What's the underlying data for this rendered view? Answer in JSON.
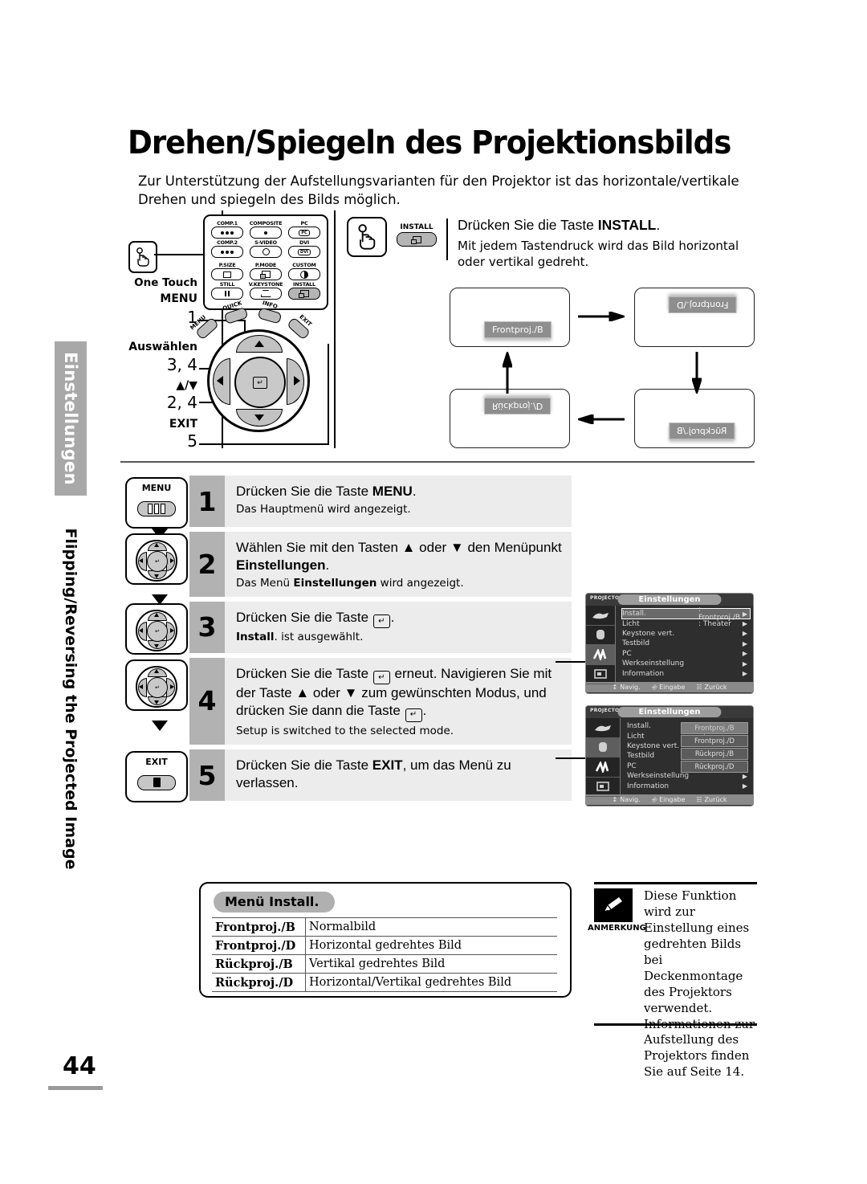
{
  "page": {
    "title": "Drehen/Spiegeln des Projektionsbilds",
    "intro": "Zur Unterstützung der Aufstellungsvarianten für den Projektor ist das horizontale/vertikale Drehen und spiegeln des Bilds möglich.",
    "number": "44"
  },
  "sidebar": {
    "tab_label": "Einstellungen",
    "sub_label": "Flipping/Reversing the Projected Image"
  },
  "remote": {
    "labels": {
      "one_touch": "One Touch",
      "menu": "MENU",
      "menu_step": "1",
      "auswaehlen": "Auswählen",
      "auswaehlen_steps": "3, 4",
      "updown": "▲/▼",
      "updown_steps": "2, 4",
      "exit": "EXIT",
      "exit_step": "5"
    },
    "source_buttons": [
      "COMP.1",
      "COMPOSITE",
      "PC",
      "COMP.2",
      "S-VIDEO",
      "DVI"
    ],
    "func_buttons": [
      "P.SIZE",
      "P.MODE",
      "CUSTOM",
      "STILL",
      "V.KEYSTONE",
      "INSTALL"
    ],
    "pad_keys": [
      "MENU",
      "QUICK",
      "INFO",
      "EXIT"
    ],
    "pc_cap": "PC",
    "dvi_cap": "DVI"
  },
  "install": {
    "key_label": "INSTALL",
    "heading_prefix": "Drücken Sie die Taste ",
    "heading_bold": "INSTALL",
    "heading_suffix": ".",
    "subtext": "Mit jedem Tastendruck wird das Bild horizontal oder vertikal gedreht."
  },
  "projection_cycle": [
    "Frontproj./B",
    "Frontproj./D",
    "Rückproj./B",
    "Rückproj./D"
  ],
  "steps": [
    {
      "number": "1",
      "key": "MENU",
      "main_pre": "Drücken Sie die Taste ",
      "main_bold": "MENU",
      "main_post": ".",
      "sub": "Das Hauptmenü wird angezeigt."
    },
    {
      "number": "2",
      "key": "",
      "main_pre": "Wählen Sie mit den Tasten ▲ oder ▼ den Menüpunkt ",
      "main_bold": "Einstellungen",
      "main_post": ".",
      "sub_pre": "Das Menü ",
      "sub_bold": "Einstellungen",
      "sub_post": " wird angezeigt."
    },
    {
      "number": "3",
      "key": "",
      "main_pre": "Drücken Sie die Taste ",
      "main_post": ".",
      "sub_bold": "Install",
      "sub_post": ". ist ausgewählt."
    },
    {
      "number": "4",
      "key": "",
      "main_pre": "Drücken Sie die Taste ",
      "main_mid": " erneut. Navigieren Sie mit der Taste ▲ oder ▼ zum gewünschten Modus, und drücken Sie dann die Taste ",
      "main_post": ".",
      "sub": "Setup is switched to the selected mode."
    },
    {
      "number": "5",
      "key": "EXIT",
      "main_pre": "Drücken Sie die Taste ",
      "main_bold": "EXIT",
      "main_post": ", um das Menü zu verlassen.",
      "sub": ""
    }
  ],
  "osd": {
    "brand": "PROJECTOR",
    "title": "Einstellungen",
    "rows": [
      {
        "name": "Install.",
        "value": ": Frontproj./B"
      },
      {
        "name": "Licht",
        "value": ": Theater"
      },
      {
        "name": "Keystone vert.",
        "value": ""
      },
      {
        "name": "Testbild",
        "value": ""
      },
      {
        "name": "PC",
        "value": ""
      },
      {
        "name": "Werkseinstellung",
        "value": ""
      },
      {
        "name": "Information",
        "value": ""
      }
    ],
    "footer": {
      "navigate": "Navig.",
      "enter": "Eingabe",
      "back": "Zurück"
    },
    "popup_options": [
      "Frontproj./B",
      "Frontproj./D",
      "Rückproj./B",
      "Rückproj./D"
    ]
  },
  "install_table": {
    "badge": "Menü Install.",
    "rows": [
      {
        "mode": "Frontproj./B",
        "desc": "Normalbild"
      },
      {
        "mode": "Frontproj./D",
        "desc": "Horizontal gedrehtes Bild"
      },
      {
        "mode": "Rückproj./B",
        "desc": "Vertikal gedrehtes Bild"
      },
      {
        "mode": "Rückproj./D",
        "desc": "Horizontal/Vertikal gedrehtes Bild"
      }
    ]
  },
  "note": {
    "tag": "ANMERKUNG",
    "text": "Diese Funktion wird zur Einstellung eines gedrehten Bilds bei Deckenmontage des Projektors verwendet. Informationen zur Aufstellung des Projektors finden Sie auf Seite 14."
  },
  "colors": {
    "gray_tab": "#a8a8a8",
    "step_num_bg": "#b2b2b2",
    "step_body_bg": "#ececec",
    "osd_bg": "#2e2e2e"
  }
}
